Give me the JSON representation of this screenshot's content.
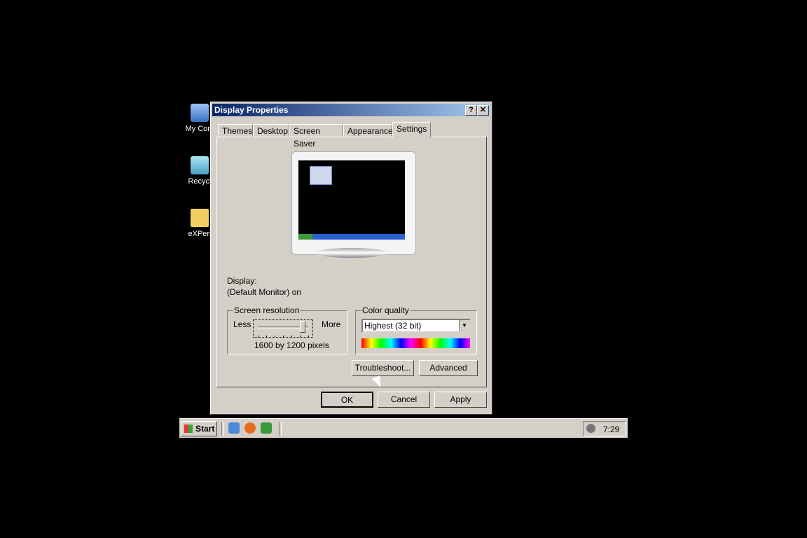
{
  "desktop": {
    "icons": [
      {
        "label": "My Com",
        "icon": "computer-icon"
      },
      {
        "label": "Recycl",
        "icon": "recycle-bin-icon"
      },
      {
        "label": "eXPeri",
        "icon": "folder-icon"
      }
    ]
  },
  "dialog": {
    "title": "Display Properties",
    "help_label": "?",
    "close_label": "✕",
    "tabs": [
      "Themes",
      "Desktop",
      "Screen Saver",
      "Appearance",
      "Settings"
    ],
    "active_tab": "Settings",
    "display_label": "Display:",
    "display_value": "(Default Monitor) on",
    "resolution": {
      "legend": "Screen resolution",
      "less": "Less",
      "more": "More",
      "value": "1600 by 1200 pixels",
      "slider_fraction": 1.0
    },
    "color_quality": {
      "legend": "Color quality",
      "selected": "Highest (32 bit)"
    },
    "buttons": {
      "troubleshoot": "Troubleshoot...",
      "advanced": "Advanced",
      "ok": "OK",
      "cancel": "Cancel",
      "apply": "Apply"
    }
  },
  "taskbar": {
    "start": "Start",
    "clock": "7:29",
    "quicklaunch": [
      "ie-icon",
      "media-icon",
      "arrow-icon"
    ]
  }
}
